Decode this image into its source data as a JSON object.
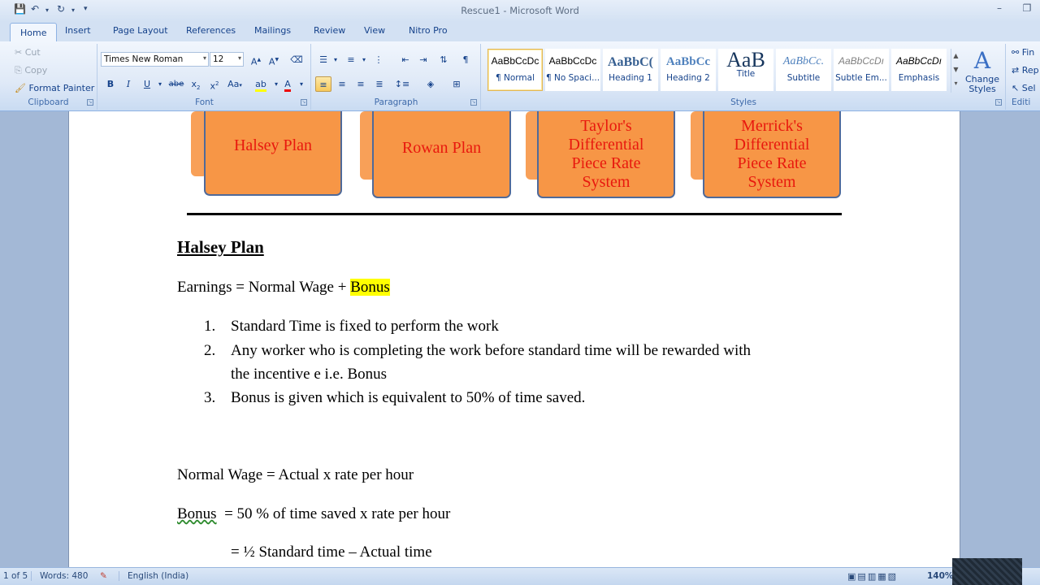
{
  "window": {
    "title": "Rescue1 - Microsoft Word"
  },
  "tabs": [
    "Home",
    "Insert",
    "Page Layout",
    "References",
    "Mailings",
    "Review",
    "View",
    "Nitro Pro"
  ],
  "active_tab": "Home",
  "clipboard": {
    "cut": "Cut",
    "copy": "Copy",
    "format_painter": "Format Painter",
    "label": "Clipboard"
  },
  "font": {
    "family": "Times New Roman",
    "size": "12",
    "label": "Font"
  },
  "paragraph": {
    "label": "Paragraph"
  },
  "styles": {
    "label": "Styles",
    "items": [
      {
        "sample": "AaBbCcDc",
        "name": "¶ Normal"
      },
      {
        "sample": "AaBbCcDc",
        "name": "¶ No Spaci..."
      },
      {
        "sample": "AaBbC(",
        "name": "Heading 1"
      },
      {
        "sample": "AaBbCc",
        "name": "Heading 2"
      },
      {
        "sample": "AaB",
        "name": "Title"
      },
      {
        "sample": "AaBbCc.",
        "name": "Subtitle"
      },
      {
        "sample": "AaBbCcDı",
        "name": "Subtle Em..."
      },
      {
        "sample": "AaBbCcDı",
        "name": "Emphasis"
      }
    ],
    "change_styles": "Change Styles"
  },
  "editing": {
    "find": "Fin",
    "replace": "Rep",
    "select": "Sel",
    "label": "Editi"
  },
  "document": {
    "boxes": [
      {
        "label": "Halsey Plan"
      },
      {
        "label": "Rowan Plan"
      },
      {
        "label": "Taylor's Differential Piece Rate System"
      },
      {
        "label": "Merrick's Differential Piece Rate System"
      }
    ],
    "heading": "Halsey Plan",
    "earnings_prefix": "Earnings = Normal Wage + ",
    "earnings_highlight": "Bonus",
    "list": [
      {
        "num": "1.",
        "text": "Standard Time is fixed to perform the work"
      },
      {
        "num": "2.",
        "text": "Any worker who is completing the work before standard time will be rewarded with",
        "cont": "the incentive e i.e. Bonus"
      },
      {
        "num": "3.",
        "text": "Bonus is given which is equivalent to 50% of time saved."
      }
    ],
    "normal_wage": "Normal Wage = Actual x rate per hour",
    "bonus_word": "Bonus",
    "bonus_rest": "  = 50 % of time saved x rate per hour",
    "bonus_line2": "= ½ Standard time – Actual time"
  },
  "status": {
    "page": "1 of 5",
    "words": "Words: 480",
    "language": "English (India)",
    "zoom": "140%"
  }
}
